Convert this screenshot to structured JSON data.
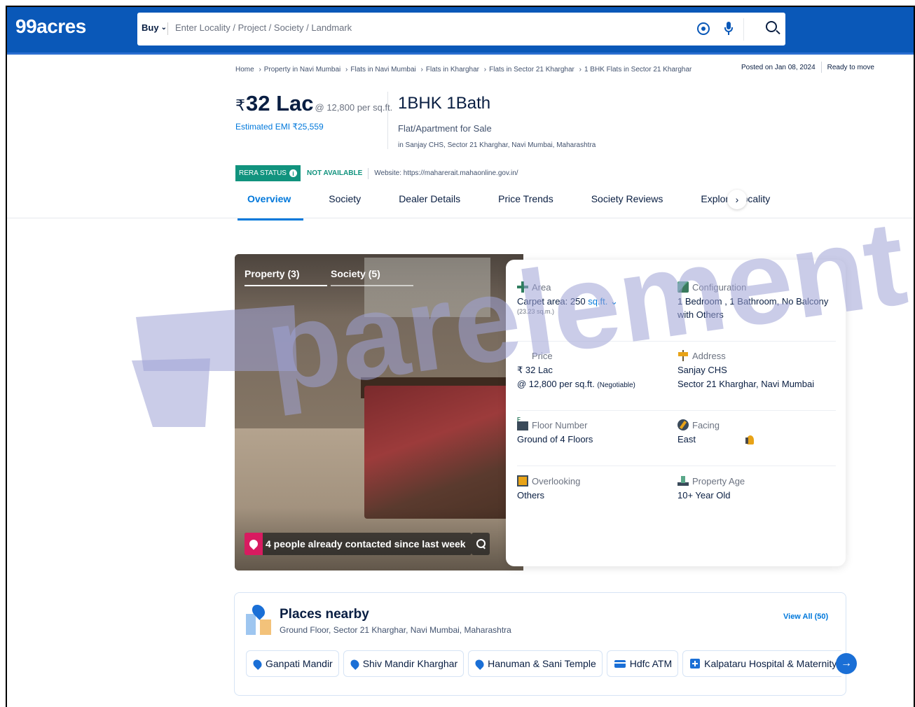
{
  "header": {
    "logo": "99acres",
    "buy_label": "Buy",
    "search_placeholder": "Enter Locality / Project / Society / Landmark",
    "icons": [
      "location-icon",
      "mic-icon",
      "search-icon"
    ]
  },
  "breadcrumb": [
    "Home",
    "Property in Navi Mumbai",
    "Flats in Navi Mumbai",
    "Flats in Kharghar",
    "Flats in Sector 21 Kharghar",
    "1 BHK Flats in Sector 21 Kharghar"
  ],
  "status": {
    "posted": "Posted on Jan 08, 2024",
    "ready": "Ready to move"
  },
  "price": {
    "currency": "₹",
    "amount": "32 Lac",
    "rate": "@ 12,800 per sq.ft.",
    "emi": "Estimated EMI ₹25,559"
  },
  "config": {
    "title": "1BHK 1Bath",
    "type": "Flat/Apartment for Sale",
    "location": "in Sanjay CHS, Sector 21 Kharghar, Navi Mumbai, Maharashtra"
  },
  "rera": {
    "label": "RERA STATUS",
    "status": "NOT AVAILABLE",
    "website": "Website: https://maharerait.mahaonline.gov.in/"
  },
  "tabs": [
    "Overview",
    "Society",
    "Dealer Details",
    "Price Trends",
    "Society Reviews",
    "Explore Locality"
  ],
  "gallery": {
    "tab_property": "Property (3)",
    "tab_society": "Society (5)",
    "contacted": "4 people already contacted since last week"
  },
  "details": {
    "area": {
      "label": "Area",
      "value": "Carpet area: 250",
      "unit": "sq.ft.",
      "sub": "(23.23 sq.m.)"
    },
    "configuration": {
      "label": "Configuration",
      "value": "1 Bedroom , 1 Bathroom, No Balcony with Others"
    },
    "price": {
      "label": "Price",
      "value": "₹ 32 Lac",
      "rate": "@ 12,800 per sq.ft.",
      "negotiable": "(Negotiable)"
    },
    "address": {
      "label": "Address",
      "line1": "Sanjay CHS",
      "line2": "Sector 21 Kharghar, Navi Mumbai"
    },
    "floor": {
      "label": "Floor Number",
      "value": "Ground of 4 Floors"
    },
    "facing": {
      "label": "Facing",
      "value": "East"
    },
    "overlooking": {
      "label": "Overlooking",
      "value": "Others"
    },
    "age": {
      "label": "Property Age",
      "value": "10+ Year Old"
    }
  },
  "places": {
    "title": "Places nearby",
    "address": "Ground Floor, Sector 21 Kharghar, Navi Mumbai, Maharashtra",
    "view_all": "View All (50)",
    "chips": [
      {
        "label": "Ganpati Mandir",
        "icon": "location-pin-icon"
      },
      {
        "label": "Shiv Mandir Kharghar",
        "icon": "location-pin-icon"
      },
      {
        "label": "Hanuman & Sani Temple",
        "icon": "location-pin-icon"
      },
      {
        "label": "Hdfc ATM",
        "icon": "atm-card-icon"
      },
      {
        "label": "Kalpataru Hospital & Maternity Clinic",
        "icon": "hospital-icon"
      }
    ]
  },
  "watermark": "parelement",
  "colors": {
    "brand": "#0a58b8",
    "accent": "#0078db",
    "rera": "#11937e",
    "watermark": "#9fa2d6"
  }
}
